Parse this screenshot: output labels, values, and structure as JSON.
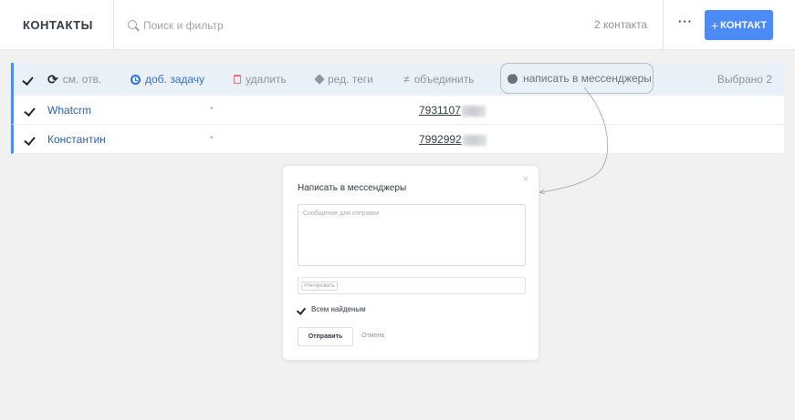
{
  "header": {
    "title": "КОНТАКТЫ",
    "search_placeholder": "Поиск и фильтр",
    "count": "2 контакта",
    "more": "···",
    "add_plus": "+",
    "add_label": "КОНТАКТ"
  },
  "toolbar": {
    "change_responsible": "см. отв.",
    "add_task": "доб. задачу",
    "delete": "удалить",
    "edit_tags": "ред. теги",
    "merge": "объединить",
    "write_messengers": "написать в мессенджеры",
    "selected": "Выбрано 2"
  },
  "rows": [
    {
      "name": "Whatcrm",
      "dot": "•",
      "phone": "7931107"
    },
    {
      "name": "Константин",
      "dot": "•",
      "phone": "7992992"
    }
  ],
  "modal": {
    "title": "Написать в мессенджеры",
    "close": "×",
    "message_placeholder": "Сообщение для отправки",
    "tag_placeholder": "#тегировать",
    "all_found_label": "Всем найденым",
    "send_label": "Отправить",
    "cancel_label": "Отмена"
  },
  "colors": {
    "accent": "#4c8bf5",
    "link": "#2b5ea8",
    "delete": "#e57373",
    "task": "#2b6fe0"
  }
}
